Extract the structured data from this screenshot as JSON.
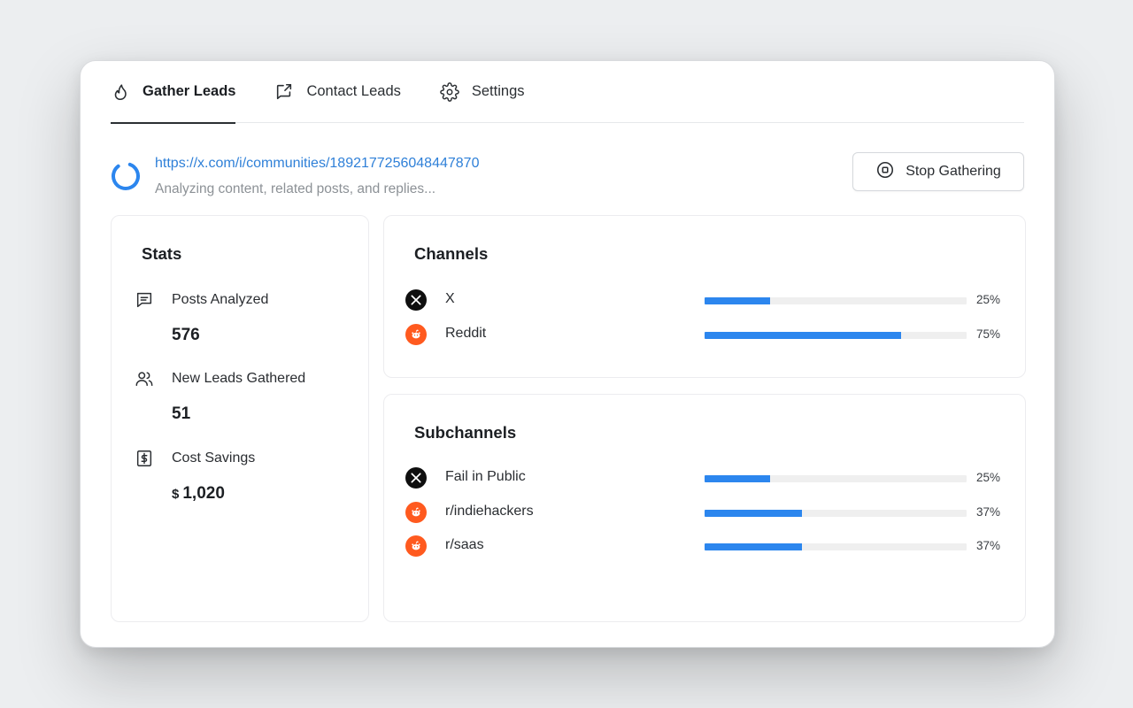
{
  "tabs": [
    {
      "label": "Gather Leads",
      "icon": "flame-icon",
      "active": true
    },
    {
      "label": "Contact Leads",
      "icon": "share-icon",
      "active": false
    },
    {
      "label": "Settings",
      "icon": "gear-icon",
      "active": false
    }
  ],
  "status": {
    "url": "https://x.com/i/communities/1892177256048447870",
    "message": "Analyzing content, related posts, and replies..."
  },
  "stop_button": {
    "label": "Stop Gathering",
    "icon": "stop-circle-icon"
  },
  "stats": {
    "title": "Stats",
    "items": [
      {
        "label": "Posts Analyzed",
        "value": "576",
        "icon": "message-icon"
      },
      {
        "label": "New Leads Gathered",
        "value": "51",
        "icon": "users-icon"
      },
      {
        "label": "Cost Savings",
        "currency": "$",
        "value": "1,020",
        "icon": "dollar-icon"
      }
    ]
  },
  "channels": {
    "title": "Channels",
    "rows": [
      {
        "name": "X",
        "platform": "x",
        "percent": 25,
        "percent_label": "25%"
      },
      {
        "name": "Reddit",
        "platform": "reddit",
        "percent": 75,
        "percent_label": "75%"
      }
    ]
  },
  "subchannels": {
    "title": "Subchannels",
    "rows": [
      {
        "name": "Fail in Public",
        "platform": "x",
        "percent": 25,
        "percent_label": "25%"
      },
      {
        "name": "r/indiehackers",
        "platform": "reddit",
        "percent": 37,
        "percent_label": "37%"
      },
      {
        "name": "r/saas",
        "platform": "reddit",
        "percent": 37,
        "percent_label": "37%"
      }
    ]
  },
  "colors": {
    "accent": "#2c86ee",
    "link": "#2f80d8",
    "reddit": "#ff5a1f",
    "x": "#0f0f0f"
  }
}
